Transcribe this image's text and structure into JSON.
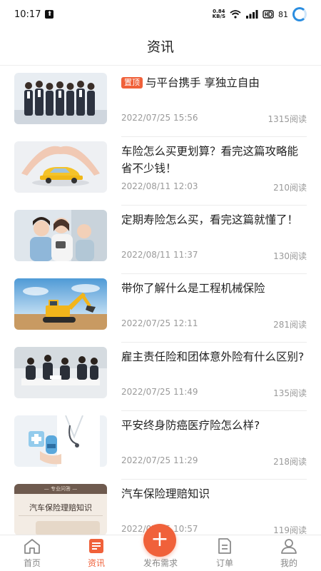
{
  "status_bar": {
    "time": "10:17",
    "net_speed_value": "0.84",
    "net_speed_unit": "KB/S",
    "battery": "81"
  },
  "header": {
    "title": "资讯"
  },
  "colors": {
    "accent": "#f0613a",
    "battery_ring": "#2a8de0"
  },
  "articles": [
    {
      "pinned": true,
      "pin_label": "置顶",
      "title": "与平台携手 享独立自由",
      "date": "2022/07/25 15:56",
      "reads": "1315阅读",
      "thumb": "business-team-photo"
    },
    {
      "pinned": false,
      "title": "车险怎么买更划算？看完这篇攻略能省不少钱！",
      "date": "2022/08/11 12:03",
      "reads": "210阅读",
      "thumb": "car-in-hands-photo"
    },
    {
      "pinned": false,
      "title": "定期寿险怎么买，看完这篇就懂了！",
      "date": "2022/08/11 11:37",
      "reads": "130阅读",
      "thumb": "family-photo"
    },
    {
      "pinned": false,
      "title": "带你了解什么是工程机械保险",
      "date": "2022/07/25 12:11",
      "reads": "281阅读",
      "thumb": "excavator-photo"
    },
    {
      "pinned": false,
      "title": "雇主责任险和团体意外险有什么区别?",
      "date": "2022/07/25 11:49",
      "reads": "135阅读",
      "thumb": "office-meeting-photo"
    },
    {
      "pinned": false,
      "title": "平安终身防癌医疗险怎么样?",
      "date": "2022/07/25 11:29",
      "reads": "218阅读",
      "thumb": "doctor-photo"
    },
    {
      "pinned": false,
      "title": "汽车保险理赔知识",
      "date": "2022/07/25 10:57",
      "reads": "119阅读",
      "thumb": "car-insurance-card",
      "thumb_text_top": "— 专业问答 —",
      "thumb_text_main": "汽车保险理赔知识"
    }
  ],
  "tab_bar": {
    "home": "首页",
    "news": "资讯",
    "publish": "发布需求",
    "orders": "订单",
    "mine": "我的"
  }
}
